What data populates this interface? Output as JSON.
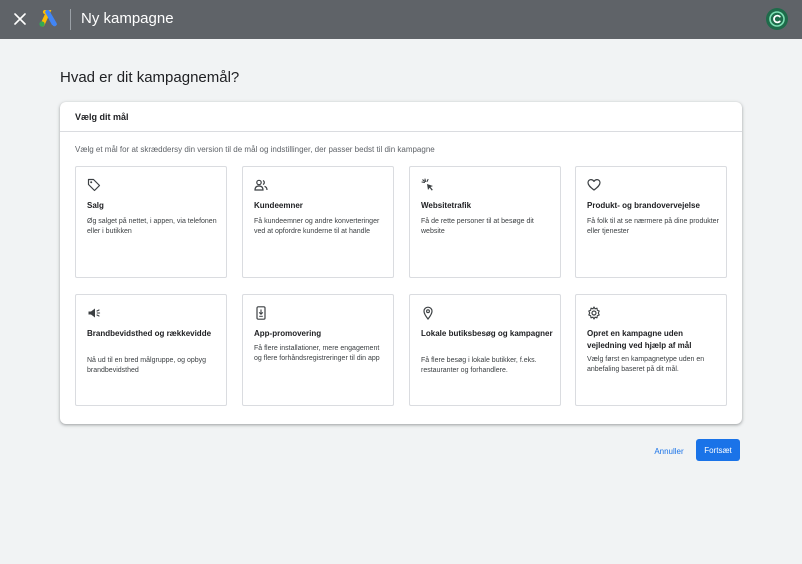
{
  "header": {
    "title": "Ny kampagne",
    "close_icon": "close-icon",
    "logo": "google-ads-logo",
    "avatar_icon": "account-avatar-icon"
  },
  "page": {
    "heading": "Hvad er dit kampagnemål?"
  },
  "panel": {
    "title": "Vælg dit mål",
    "description": "Vælg et mål for at skræddersy din version til de mål og indstillinger, der passer bedst til din kampagne"
  },
  "goals": [
    {
      "icon": "tag-icon",
      "title": "Salg",
      "description": "Øg salget på nettet, i appen, via telefonen eller i butikken"
    },
    {
      "icon": "people-icon",
      "title": "Kundeemner",
      "description": "Få kundeemner og andre konverteringer ved at opfordre kunderne til at handle"
    },
    {
      "icon": "cursor-click-icon",
      "title": "Websitetrafik",
      "description": "Få de rette personer til at besøge dit website"
    },
    {
      "icon": "heart-icon",
      "title": "Produkt- og brandovervejelse",
      "description": "Få folk til at se nærmere på dine produkter eller tjenester"
    },
    {
      "icon": "megaphone-icon",
      "title": "Brandbevidsthed og rækkevidde",
      "description": "Nå ud til en bred målgruppe, og opbyg brandbevidsthed"
    },
    {
      "icon": "phone-download-icon",
      "title": "App-promovering",
      "description": "Få flere installationer, mere engagement og flere forhåndsregistreringer til din app"
    },
    {
      "icon": "location-pin-icon",
      "title": "Lokale butiksbesøg og kampagner",
      "description": "Få flere besøg i lokale butikker, f.eks. restauranter og forhandlere."
    },
    {
      "icon": "gear-icon",
      "title": "Opret en kampagne uden vejledning ved hjælp af mål",
      "description": "Vælg først en kampagnetype uden en anbefaling baseret på dit mål."
    }
  ],
  "actions": {
    "cancel": "Annuller",
    "continue": "Fortsæt"
  },
  "colors": {
    "topbar": "#5f6368",
    "accent": "#1a73e8",
    "background": "#f1f3f4"
  }
}
